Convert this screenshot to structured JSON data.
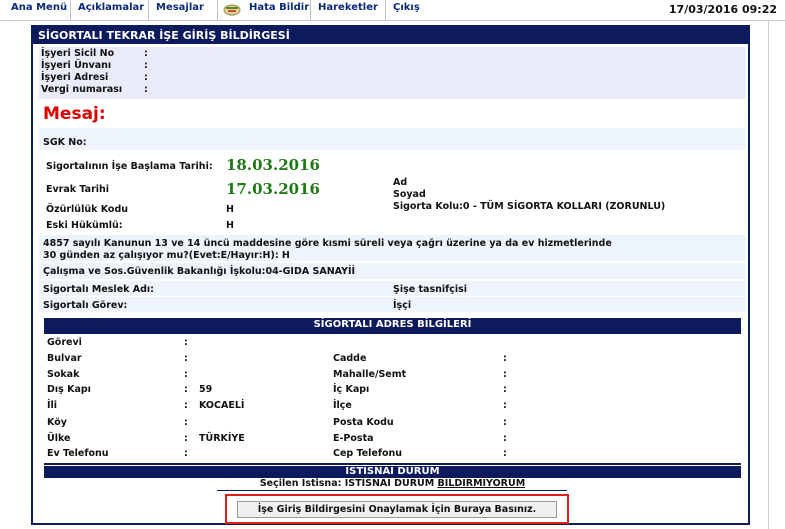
{
  "menu": {
    "items": [
      "Ana Menü",
      "Açıklamalar",
      "Mesajlar",
      "Hata Bildir",
      "Hareketler",
      "Çıkış"
    ],
    "datetime": "17/03/2016 09:22"
  },
  "panel": {
    "title": "SİGORTALI TEKRAR İŞE GİRİŞ BİLDİRGESİ"
  },
  "employer": {
    "sicil_label": "İşyeri Sicil No",
    "unvan_label": "İşyeri Ünvanı",
    "adres_label": "İşyeri Adresi",
    "vergi_label": "Vergi numarası",
    "colon": ":"
  },
  "message": {
    "label": "Mesaj:"
  },
  "insured": {
    "sgk_label": "SGK No:",
    "start_date_label": "Sigortalının İşe Başlama Tarihi:",
    "start_date": "18.03.2016",
    "doc_date_label": "Evrak Tarihi",
    "doc_date": "17.03.2016",
    "ad_label": "Ad",
    "soyad_label": "Soyad",
    "sigorta_kolu": "Sigorta Kolu:0 - TÜM SİGORTA KOLLARI (ZORUNLU)",
    "ozurluluk_label": "Özürlülük Kodu",
    "ozurluluk_value": "H",
    "eski_hukumlu_label": "Eski Hükümlü:",
    "eski_hukumlu_value": "H",
    "kanun_line1": "4857 sayılı Kanunun 13 ve 14 üncü maddesine göre kısmi süreli veya çağrı üzerine ya da ev hizmetlerinde",
    "kanun_line2": "30 günden az çalışıyor mu?(Evet:E/Hayır:H): H",
    "bakanlik": "Çalışma ve Sos.Güvenlik Bakanlığı İşkolu:04-GIDA SANAYİİ",
    "meslek_label": "Sigortalı Meslek Adı:",
    "meslek_value": "Şişe tasnifçisi",
    "gorev_label": "Sigortalı Görev:",
    "gorev_value": "İşçi"
  },
  "address": {
    "title": "SİGORTALI ADRES BİLGİLERİ",
    "colon": ":",
    "left": [
      {
        "label": "Görevi",
        "value": ""
      },
      {
        "label": "Bulvar",
        "value": ""
      },
      {
        "label": "Sokak",
        "value": ""
      },
      {
        "label": "Dış Kapı",
        "value": "59"
      },
      {
        "label": "İli",
        "value": "KOCAELİ"
      },
      {
        "label": "Köy",
        "value": ""
      },
      {
        "label": "Ülke",
        "value": "TÜRKİYE"
      },
      {
        "label": "Ev Telefonu",
        "value": ""
      }
    ],
    "right": [
      {
        "label": "Cadde",
        "value": ""
      },
      {
        "label": "Mahalle/Semt",
        "value": ""
      },
      {
        "label": "İç Kapı",
        "value": ""
      },
      {
        "label": "İlçe",
        "value": ""
      },
      {
        "label": "Posta Kodu",
        "value": ""
      },
      {
        "label": "E-Posta",
        "value": ""
      },
      {
        "label": "Cep Telefonu",
        "value": ""
      }
    ]
  },
  "exception": {
    "title": "İSTİSNAİ DURUM",
    "selected_prefix": "Seçilen İstisna:",
    "selected_value_main": "İSTİSNAİ DURUM",
    "selected_value_link": "BİLDİRMİYORUM"
  },
  "confirm": {
    "button_label": "İşe Giriş Bildirgesini Onaylamak İçin Buraya Basınız."
  },
  "colors": {
    "navy": "#0e1a5e",
    "menu_text": "#0a2a7a",
    "message_red": "#e00000",
    "date_green": "#1e7a14",
    "highlight_red": "#e02020"
  }
}
